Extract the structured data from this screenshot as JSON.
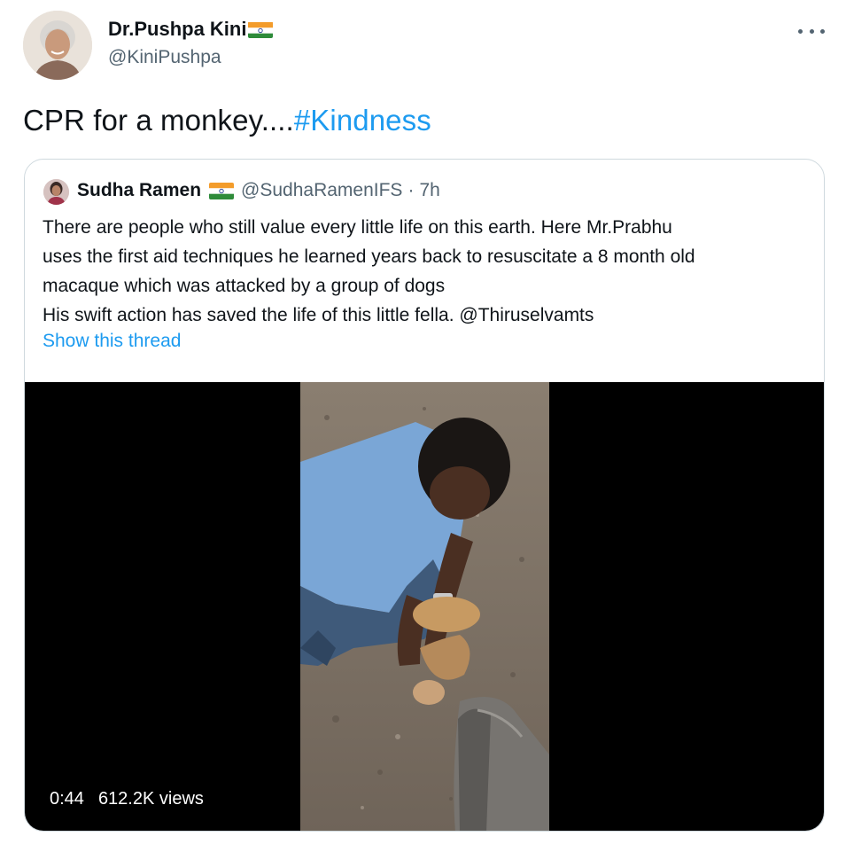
{
  "author": {
    "display_name": "Dr.Pushpa Kini",
    "handle": "@KiniPushpa",
    "flag_icon": "india-flag-icon"
  },
  "tweet": {
    "text": "CPR for a monkey....",
    "hashtag": "#Kindness"
  },
  "quoted_tweet": {
    "display_name": "Sudha Ramen",
    "handle": "@SudhaRamenIFS",
    "separator": "·",
    "time": "7h",
    "lines": [
      "There are people who still value every little life on this earth. Here Mr.Prabhu",
      "uses the first aid techniques he learned years back to resuscitate a 8 month old",
      "macaque which was attacked by a group of dogs",
      "His swift action has saved the life of this little fella. @Thiruselvamts"
    ],
    "show_thread": "Show this thread"
  },
  "video": {
    "duration": "0:44",
    "views": "612.2K views"
  },
  "colors": {
    "accent": "#1d9bf0",
    "secondary_text": "#536471",
    "border": "#cfd9de"
  }
}
